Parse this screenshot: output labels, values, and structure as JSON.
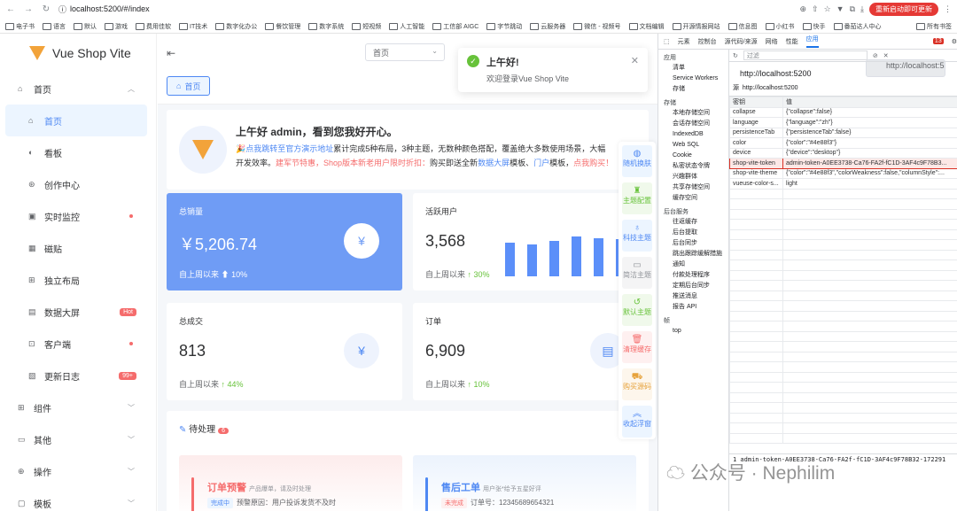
{
  "browser": {
    "url": "localhost:5200/#/index",
    "update_btn": "重新启动即可更新",
    "bookmarks": [
      "电子书",
      "语言",
      "默认",
      "游戏",
      "费用佳软",
      "IT技术",
      "数字化办公",
      "餐饮管理",
      "数字系统",
      "短视频",
      "人工智能",
      "工信部 AIGC",
      "字节跳动",
      "云服务器",
      "微信 - 视频号",
      "文档编辑",
      "开源情报网站",
      "信息图",
      "小红书",
      "快手",
      "番茄达人中心"
    ],
    "all_bookmarks": "所有书签"
  },
  "app": {
    "name": "Vue Shop Vite"
  },
  "sidebar": {
    "items": [
      {
        "label": "首页",
        "icon": "home-icon",
        "expanded": true
      },
      {
        "label": "首页",
        "sub": true,
        "active": true
      },
      {
        "label": "看板",
        "sub": true
      },
      {
        "label": "创作中心",
        "sub": true
      },
      {
        "label": "实时监控",
        "sub": true,
        "dot": true
      },
      {
        "label": "磁贴",
        "sub": true
      },
      {
        "label": "独立布局",
        "sub": true
      },
      {
        "label": "数据大屏",
        "sub": true,
        "badge": "Hot"
      },
      {
        "label": "客户端",
        "sub": true,
        "dot": true
      },
      {
        "label": "更新日志",
        "sub": true,
        "badge": "99+"
      },
      {
        "label": "组件"
      },
      {
        "label": "其他"
      },
      {
        "label": "操作"
      },
      {
        "label": "模板"
      }
    ]
  },
  "header": {
    "select_value": "首页",
    "tab_label": "首页"
  },
  "toast": {
    "title": "上午好!",
    "message": "欢迎登录Vue Shop Vite"
  },
  "welcome": {
    "title": "上午好 admin，看到您我好开心。",
    "line1": "点我跳转至官方演示地址",
    "line1b": "累计完成5种布局，3种主题，无数种颜色搭配，覆盖绝大多数使用场景，大幅",
    "line2a": "开发效率。",
    "line2b": "建军节特惠，Shop版本新老用户限时折扣：",
    "line2c": "购买即送全新",
    "line2d": "数据大屏",
    "line2e": "模板、",
    "line2f": "门户",
    "line2g": "模板，",
    "line2h": "点我购买！"
  },
  "stats": [
    {
      "label": "总销量",
      "value": "￥5,206.74",
      "foot": "自上周以来",
      "pct": "10%"
    },
    {
      "label": "活跃用户",
      "value": "3,568",
      "foot": "自上周以来",
      "pct": "30%"
    },
    {
      "label": "总成交",
      "value": "813",
      "foot": "自上周以来",
      "pct": "44%"
    },
    {
      "label": "订单",
      "value": "6,909",
      "foot": "自上周以来",
      "pct": "10%"
    }
  ],
  "mini_bars": [
    0.7,
    0.66,
    0.74,
    0.84,
    0.8,
    0.78,
    0.58
  ],
  "todo": {
    "title": "待处理",
    "count": "6",
    "a": {
      "title": "订单预警",
      "sub": "产品爆单，请及时处理",
      "tag": "完成中",
      "text": "预警原因：用户投诉发货不及时"
    },
    "b": {
      "title": "售后工单",
      "sub": "用户张*给予五星好评",
      "tag": "未完成",
      "text": "订单号：12345689654321"
    }
  },
  "quick": [
    {
      "label": "随机换肤",
      "icon": "drop-icon",
      "color": "#4e88f3",
      "bg": "#ecf5ff"
    },
    {
      "label": "主题配置",
      "icon": "shirt-icon",
      "color": "#67c23a",
      "bg": "#f0f9eb"
    },
    {
      "label": "科技主题",
      "icon": "balloon-icon",
      "color": "#4e88f3",
      "bg": "#ecf5ff"
    },
    {
      "label": "简洁主题",
      "icon": "monitor-icon",
      "color": "#909399",
      "bg": "#f4f4f5"
    },
    {
      "label": "默认主题",
      "icon": "return-icon",
      "color": "#67c23a",
      "bg": "#f0f9eb"
    },
    {
      "label": "清理缓存",
      "icon": "trash-icon",
      "color": "#f56c6c",
      "bg": "#fef0f0"
    },
    {
      "label": "购买源码",
      "icon": "cart-icon",
      "color": "#e6a23c",
      "bg": "#fdf6ec"
    },
    {
      "label": "收起浮窗",
      "icon": "collapse-icon",
      "color": "#4e88f3",
      "bg": "#ecf5ff"
    }
  ],
  "devtools": {
    "tabs": [
      "元素",
      "控制台",
      "源代码/来源",
      "网络",
      "性能",
      "应用"
    ],
    "active_tab": "应用",
    "errors": "13",
    "tree": {
      "app": "应用",
      "app_items": [
        "清单",
        "Service Workers",
        "存储"
      ],
      "storage": "存储",
      "storage_items": [
        "本地存储空间",
        "http://localhost:5200",
        "会话存储空间",
        "IndexedDB",
        "Web SQL",
        "Cookie",
        "私密状态令牌",
        "兴趣群体",
        "共享存储空间",
        "缓存空间"
      ],
      "bg": "后台服务",
      "bg_items": [
        "往返缓存",
        "后台提取",
        "后台同步",
        "跳出跟踪缓解措施",
        "通知",
        "付款处理程序",
        "定期后台同步",
        "推送消息",
        "报告 API"
      ],
      "frames": "帧",
      "frame_items": [
        "top"
      ]
    },
    "filter_placeholder": "过滤",
    "origin": "http://localhost:5200",
    "source_label": "源",
    "source": "http://localhost:5200",
    "headers": [
      "密钥",
      "值"
    ],
    "rows": [
      [
        "collapse",
        "{\"collapse\":false}"
      ],
      [
        "language",
        "{\"language\":\"zh\"}"
      ],
      [
        "persistenceTab",
        "{\"persistenceTab\":false}"
      ],
      [
        "color",
        "{\"color\":\"#4e88f3\"}"
      ],
      [
        "device",
        "{\"device\":\"desktop\"}"
      ],
      [
        "shop-vite-token",
        "admin-token-A0EE3738-Ca76-FA2f-fC1D-3AF4c9F78B3..."
      ],
      [
        "shop-vite-theme",
        "{\"color\":\"#4e88f3\",\"colorWeakness\":false,\"columnStyle\":..."
      ],
      [
        "vueuse-color-s...",
        "light"
      ]
    ],
    "bottom_value": "1  admin-token-A0EE3738-Ca76-FA2f-fC1D-3AF4c9F78B32-172291"
  },
  "watermark": "公众号 · Nephilim"
}
